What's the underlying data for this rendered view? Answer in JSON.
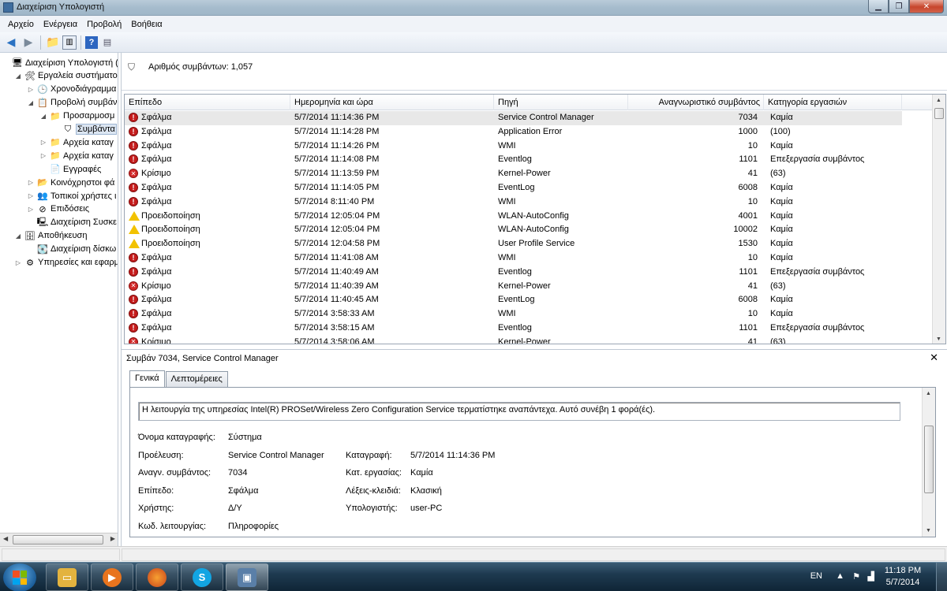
{
  "window": {
    "title": "Διαχείριση Υπολογιστή"
  },
  "menu": [
    "Αρχείο",
    "Ενέργεια",
    "Προβολή",
    "Βοήθεια"
  ],
  "tree": [
    {
      "label": "Διαχείριση Υπολογιστή (",
      "indent": 0,
      "exp": "",
      "icon": "computer-icon",
      "glyph": "🖥"
    },
    {
      "label": "Εργαλεία συστήματο",
      "indent": 1,
      "exp": "◢",
      "icon": "tools-icon",
      "glyph": "🛠"
    },
    {
      "label": "Χρονοδιάγραμμα",
      "indent": 2,
      "exp": "▷",
      "icon": "clock-icon",
      "glyph": "🕒"
    },
    {
      "label": "Προβολή συμβάν",
      "indent": 2,
      "exp": "◢",
      "icon": "event-viewer-icon",
      "glyph": "📋"
    },
    {
      "label": "Προσαρμοσμ",
      "indent": 3,
      "exp": "◢",
      "icon": "folder-icon",
      "glyph": "📁"
    },
    {
      "label": "Συμβάντα",
      "indent": 4,
      "exp": "",
      "icon": "filter-icon",
      "glyph": "⛉",
      "selected": true
    },
    {
      "label": "Αρχεία καταγ",
      "indent": 3,
      "exp": "▷",
      "icon": "folder-icon",
      "glyph": "📁"
    },
    {
      "label": "Αρχεία καταγ",
      "indent": 3,
      "exp": "▷",
      "icon": "folder-icon",
      "glyph": "📁"
    },
    {
      "label": "Εγγραφές",
      "indent": 3,
      "exp": "",
      "icon": "subscriptions-icon",
      "glyph": "📄"
    },
    {
      "label": "Κοινόχρηστοι φά",
      "indent": 2,
      "exp": "▷",
      "icon": "shared-folder-icon",
      "glyph": "📂"
    },
    {
      "label": "Τοπικοί χρήστες ι",
      "indent": 2,
      "exp": "▷",
      "icon": "users-icon",
      "glyph": "👥"
    },
    {
      "label": "Επιδόσεις",
      "indent": 2,
      "exp": "▷",
      "icon": "performance-icon",
      "glyph": "⊘"
    },
    {
      "label": "Διαχείριση Συσκε",
      "indent": 2,
      "exp": "",
      "icon": "device-manager-icon",
      "glyph": "🖳"
    },
    {
      "label": "Αποθήκευση",
      "indent": 1,
      "exp": "◢",
      "icon": "storage-icon",
      "glyph": "🗄"
    },
    {
      "label": "Διαχείριση δίσκω",
      "indent": 2,
      "exp": "",
      "icon": "disk-icon",
      "glyph": "💽"
    },
    {
      "label": "Υπηρεσίες και εφαρμ",
      "indent": 1,
      "exp": "▷",
      "icon": "services-icon",
      "glyph": "⚙"
    }
  ],
  "filter": {
    "count_text": "Αριθμός συμβάντων: 1,057"
  },
  "grid": {
    "columns": [
      "Επίπεδο",
      "Ημερομηνία και ώρα",
      "Πηγή",
      "Αναγνωριστικό συμβάντος",
      "Κατηγορία εργασιών"
    ],
    "rows": [
      {
        "level": "Σφάλμα",
        "type": "error",
        "date": "5/7/2014 11:14:36 PM",
        "source": "Service Control Manager",
        "id": "7034",
        "cat": "Καμία",
        "selected": true
      },
      {
        "level": "Σφάλμα",
        "type": "error",
        "date": "5/7/2014 11:14:28 PM",
        "source": "Application Error",
        "id": "1000",
        "cat": "(100)"
      },
      {
        "level": "Σφάλμα",
        "type": "error",
        "date": "5/7/2014 11:14:26 PM",
        "source": "WMI",
        "id": "10",
        "cat": "Καμία"
      },
      {
        "level": "Σφάλμα",
        "type": "error",
        "date": "5/7/2014 11:14:08 PM",
        "source": "Eventlog",
        "id": "1101",
        "cat": "Επεξεργασία συμβάντος"
      },
      {
        "level": "Κρίσιμο",
        "type": "critical",
        "date": "5/7/2014 11:13:59 PM",
        "source": "Kernel-Power",
        "id": "41",
        "cat": "(63)"
      },
      {
        "level": "Σφάλμα",
        "type": "error",
        "date": "5/7/2014 11:14:05 PM",
        "source": "EventLog",
        "id": "6008",
        "cat": "Καμία"
      },
      {
        "level": "Σφάλμα",
        "type": "error",
        "date": "5/7/2014 8:11:40 PM",
        "source": "WMI",
        "id": "10",
        "cat": "Καμία"
      },
      {
        "level": "Προειδοποίηση",
        "type": "warning",
        "date": "5/7/2014 12:05:04 PM",
        "source": "WLAN-AutoConfig",
        "id": "4001",
        "cat": "Καμία"
      },
      {
        "level": "Προειδοποίηση",
        "type": "warning",
        "date": "5/7/2014 12:05:04 PM",
        "source": "WLAN-AutoConfig",
        "id": "10002",
        "cat": "Καμία"
      },
      {
        "level": "Προειδοποίηση",
        "type": "warning",
        "date": "5/7/2014 12:04:58 PM",
        "source": "User Profile Service",
        "id": "1530",
        "cat": "Καμία"
      },
      {
        "level": "Σφάλμα",
        "type": "error",
        "date": "5/7/2014 11:41:08 AM",
        "source": "WMI",
        "id": "10",
        "cat": "Καμία"
      },
      {
        "level": "Σφάλμα",
        "type": "error",
        "date": "5/7/2014 11:40:49 AM",
        "source": "Eventlog",
        "id": "1101",
        "cat": "Επεξεργασία συμβάντος"
      },
      {
        "level": "Κρίσιμο",
        "type": "critical",
        "date": "5/7/2014 11:40:39 AM",
        "source": "Kernel-Power",
        "id": "41",
        "cat": "(63)"
      },
      {
        "level": "Σφάλμα",
        "type": "error",
        "date": "5/7/2014 11:40:45 AM",
        "source": "EventLog",
        "id": "6008",
        "cat": "Καμία"
      },
      {
        "level": "Σφάλμα",
        "type": "error",
        "date": "5/7/2014 3:58:33 AM",
        "source": "WMI",
        "id": "10",
        "cat": "Καμία"
      },
      {
        "level": "Σφάλμα",
        "type": "error",
        "date": "5/7/2014 3:58:15 AM",
        "source": "Eventlog",
        "id": "1101",
        "cat": "Επεξεργασία συμβάντος"
      },
      {
        "level": "Κρίσιμο",
        "type": "critical",
        "date": "5/7/2014 3:58:06 AM",
        "source": "Kernel-Power",
        "id": "41",
        "cat": "(63)"
      }
    ]
  },
  "details": {
    "title": "Συμβάν 7034, Service Control Manager",
    "tabs": [
      "Γενικά",
      "Λεπτομέρειες"
    ],
    "message": "Η λειτουργία της υπηρεσίας Intel(R) PROSet/Wireless Zero Configuration Service τερματίστηκε αναπάντεχα. Αυτό συνέβη 1 φορά(ές).",
    "log_name_label": "Όνομα καταγραφής:",
    "log_name": "Σύστημα",
    "source_label": "Προέλευση:",
    "source": "Service Control Manager",
    "logged_label": "Καταγραφή:",
    "logged": "5/7/2014 11:14:36 PM",
    "event_id_label": "Αναγν. συμβάντος:",
    "event_id": "7034",
    "task_label": "Κατ. εργασίας:",
    "task": "Καμία",
    "level_label": "Επίπεδο:",
    "level": "Σφάλμα",
    "keywords_label": "Λέξεις-κλειδιά:",
    "keywords": "Κλασική",
    "user_label": "Χρήστης:",
    "user": "Δ/Υ",
    "computer_label": "Υπολογιστής:",
    "computer": "user-PC",
    "opcode_label": "Κωδ. λειτουργίας:",
    "opcode": "Πληροφορίες"
  },
  "taskbar": {
    "lang": "EN",
    "time": "11:18 PM",
    "date": "5/7/2014"
  }
}
